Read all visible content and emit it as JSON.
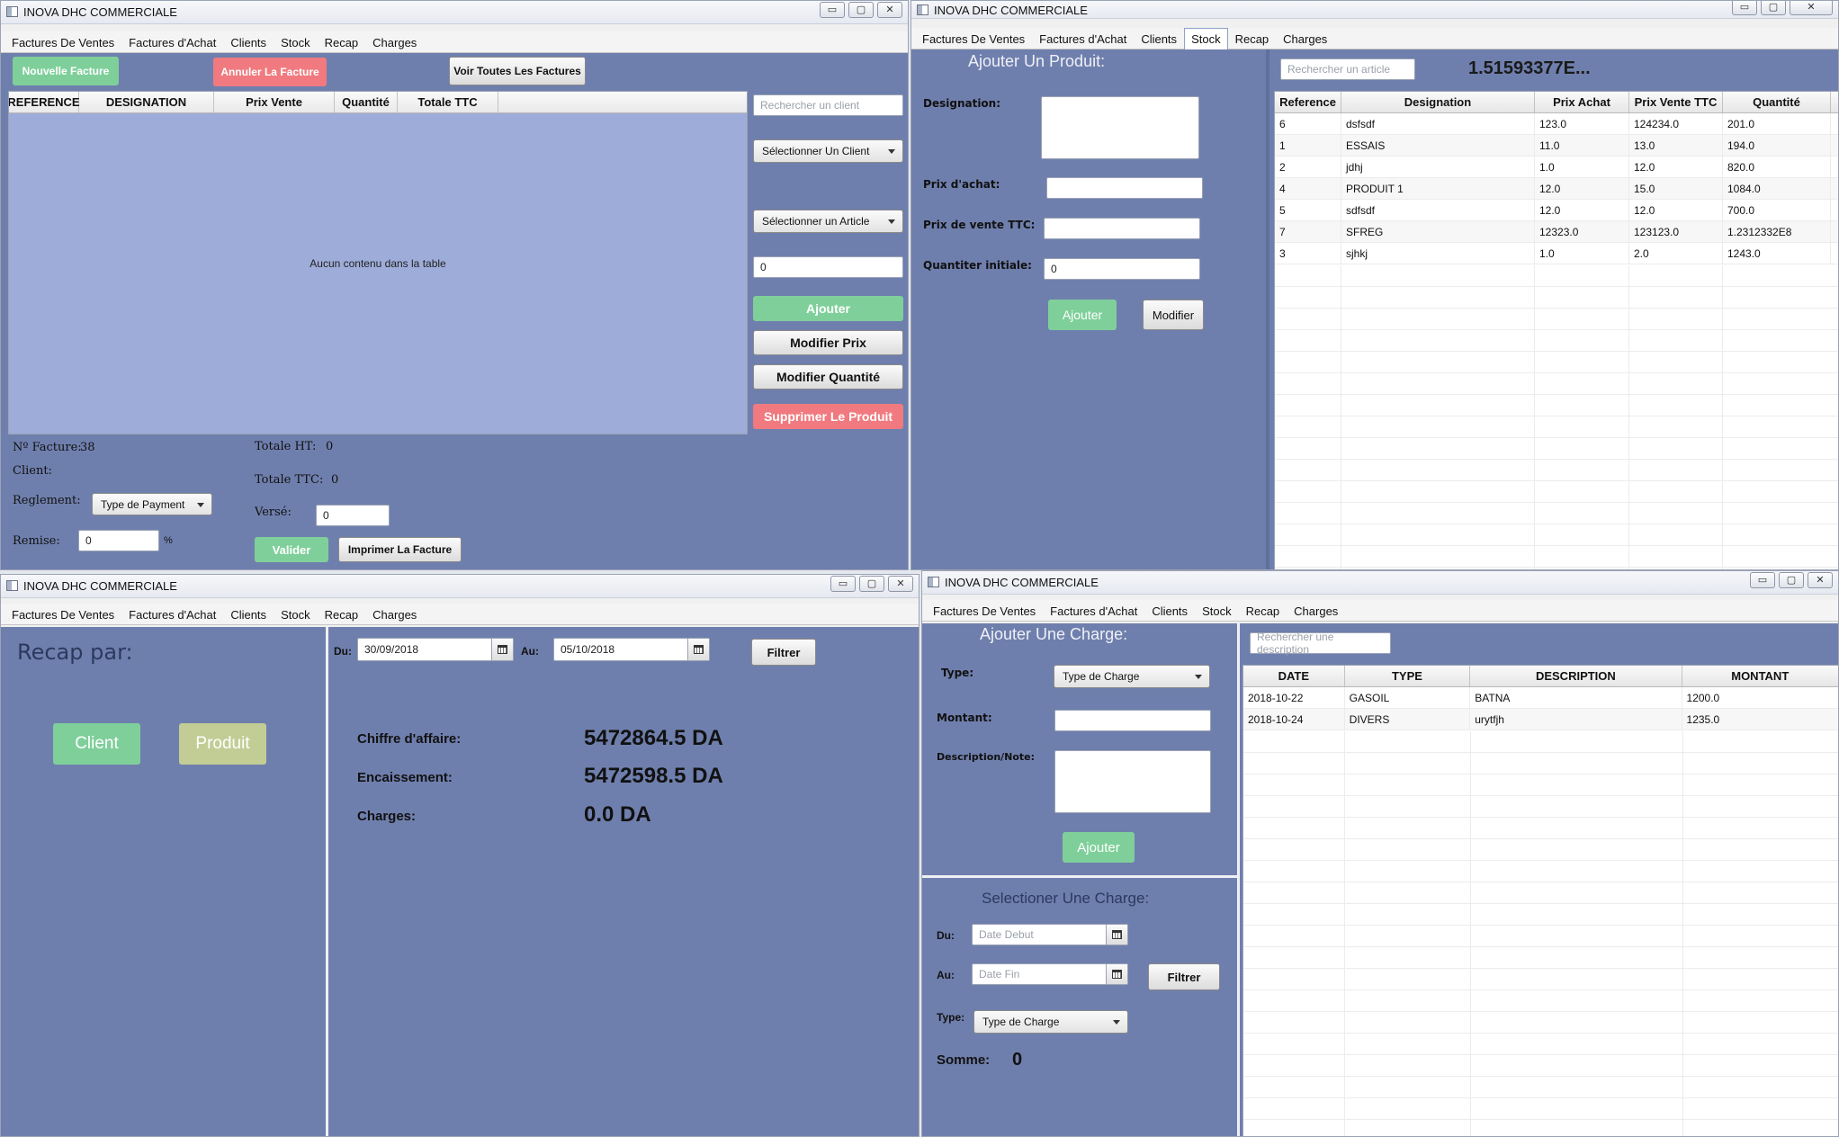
{
  "app_title": "INOVA DHC COMMERCIALE",
  "window_controls": {
    "minimize": "▭",
    "maximize": "▢",
    "close": "✕"
  },
  "menu": [
    "Factures De Ventes",
    "Factures d'Achat",
    "Clients",
    "Stock",
    "Recap",
    "Charges"
  ],
  "ventes": {
    "nouvelle_facture": "Nouvelle Facture",
    "annuler_facture": "Annuler La Facture",
    "voir_factures": "Voir Toutes Les Factures",
    "columns": [
      "REFERENCE",
      "DESIGNATION",
      "Prix Vente",
      "Quantité",
      "Totale TTC"
    ],
    "empty_table": "Aucun contenu dans la table",
    "search_client_placeholder": "Rechercher un client",
    "select_client": "Sélectionner Un Client",
    "select_article": "Sélectionner un Article",
    "quantity_value": "0",
    "btn_ajouter": "Ajouter",
    "btn_modifier_prix": "Modifier Prix",
    "btn_modifier_quantite": "Modifier Quantité",
    "btn_supprimer": "Supprimer Le Produit",
    "facture_no_label": "Nº Facture:",
    "facture_no_value": "38",
    "client_label": "Client:",
    "reglement_label": "Reglement:",
    "type_payment": "Type de Payment",
    "remise_label": "Remise:",
    "remise_value": "0",
    "percent": "%",
    "totale_ht_label": "Totale HT:",
    "totale_ht_value": "0",
    "totale_ttc_label": "Totale TTC:",
    "totale_ttc_value": "0",
    "verse_label": "Versé:",
    "verse_value": "0",
    "btn_valider": "Valider",
    "btn_imprimer": "Imprimer La Facture"
  },
  "stock": {
    "title": "Ajouter Un Produit:",
    "designation_label": "Designation:",
    "prix_achat_label": "Prix d'achat:",
    "prix_vente_label": "Prix de vente TTC:",
    "quantite_label": "Quantiter initiale:",
    "quantite_value": "0",
    "btn_ajouter": "Ajouter",
    "btn_modifier": "Modifier",
    "search_placeholder": "Rechercher un article",
    "total_value": "1.51593377E...",
    "columns": [
      "Reference",
      "Designation",
      "Prix Achat",
      "Prix Vente TTC",
      "Quantité"
    ],
    "rows": [
      [
        "6",
        "dsfsdf",
        "123.0",
        "124234.0",
        "201.0"
      ],
      [
        "1",
        "ESSAIS",
        "11.0",
        "13.0",
        "194.0"
      ],
      [
        "2",
        "jdhj",
        "1.0",
        "12.0",
        "820.0"
      ],
      [
        "4",
        "PRODUIT 1",
        "12.0",
        "15.0",
        "1084.0"
      ],
      [
        "5",
        "sdfsdf",
        "12.0",
        "12.0",
        "700.0"
      ],
      [
        "7",
        "SFREG",
        "12323.0",
        "123123.0",
        "1.2312332E8"
      ],
      [
        "3",
        "sjhkj",
        "1.0",
        "2.0",
        "1243.0"
      ]
    ]
  },
  "recap": {
    "title": "Recap par:",
    "btn_client": "Client",
    "btn_produit": "Produit",
    "du_label": "Du:",
    "du_value": "30/09/2018",
    "au_label": "Au:",
    "au_value": "05/10/2018",
    "btn_filtrer": "Filtrer",
    "chiffre_label": "Chiffre d'affaire:",
    "chiffre_value": "5472864.5 DA",
    "encaissement_label": "Encaissement:",
    "encaissement_value": "5472598.5 DA",
    "charges_label": "Charges:",
    "charges_value": "0.0 DA"
  },
  "charges": {
    "title": "Ajouter Une Charge:",
    "type_label": "Type:",
    "type_placeholder": "Type de Charge",
    "montant_label": "Montant:",
    "description_label": "Description/Note:",
    "btn_ajouter": "Ajouter",
    "select_title": "Selectioner Une Charge:",
    "du_label": "Du:",
    "du_placeholder": "Date Debut",
    "au_label": "Au:",
    "au_placeholder": "Date Fin",
    "btn_filtrer": "Filtrer",
    "type2_label": "Type:",
    "type2_placeholder": "Type de Charge",
    "somme_label": "Somme:",
    "somme_value": "0",
    "search_placeholder": "Rechercher une description",
    "columns": [
      "DATE",
      "TYPE",
      "DESCRIPTION",
      "MONTANT"
    ],
    "rows": [
      [
        "2018-10-22",
        "GASOIL",
        "BATNA",
        "1200.0"
      ],
      [
        "2018-10-24",
        "DIVERS",
        "urytfjh",
        "1235.0"
      ]
    ]
  }
}
